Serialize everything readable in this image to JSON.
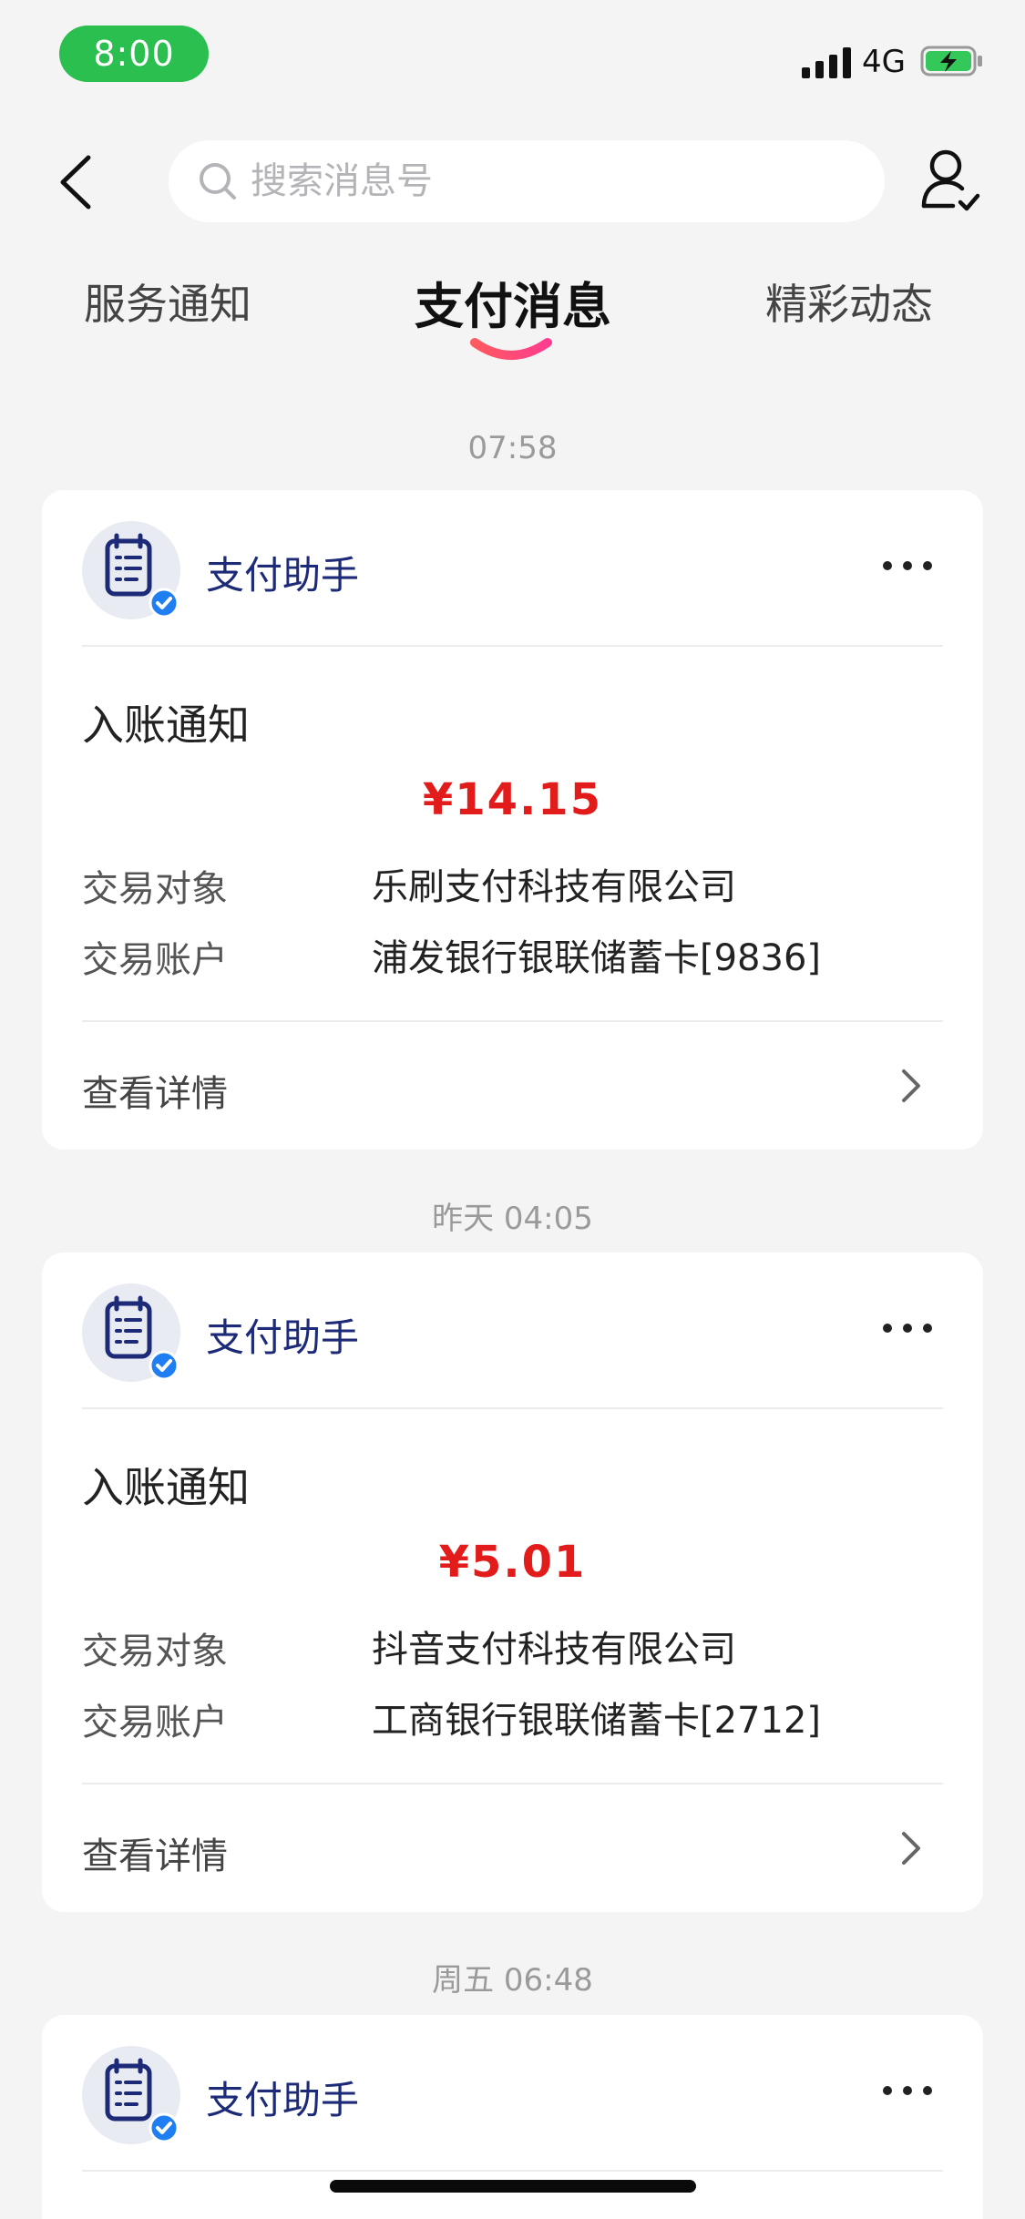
{
  "status_bar": {
    "time": "8:00",
    "network": "4G",
    "time_pill_color": "#2bbf4f"
  },
  "header": {
    "search_placeholder": "搜索消息号"
  },
  "tabs": [
    {
      "label": "服务通知",
      "active": false
    },
    {
      "label": "支付消息",
      "active": true
    },
    {
      "label": "精彩动态",
      "active": false
    }
  ],
  "messages": [
    {
      "time": "07:58",
      "sender": "支付助手",
      "title": "入账通知",
      "amount": "¥14.15",
      "counterparty_label": "交易对象",
      "counterparty": "乐刷支付科技有限公司",
      "account_label": "交易账户",
      "account": "浦发银行银联储蓄卡[9836]",
      "detail": "查看详情"
    },
    {
      "time": "昨天 04:05",
      "sender": "支付助手",
      "title": "入账通知",
      "amount": "¥5.01",
      "counterparty_label": "交易对象",
      "counterparty": "抖音支付科技有限公司",
      "account_label": "交易账户",
      "account": "工商银行银联储蓄卡[2712]",
      "detail": "查看详情"
    },
    {
      "time": "周五 06:48",
      "sender": "支付助手"
    }
  ],
  "colors": {
    "amount": "#e21b1b",
    "sender": "#1c2a78",
    "tab_indicator_start": "#ff5a5f",
    "tab_indicator_end": "#ff3d8f"
  }
}
